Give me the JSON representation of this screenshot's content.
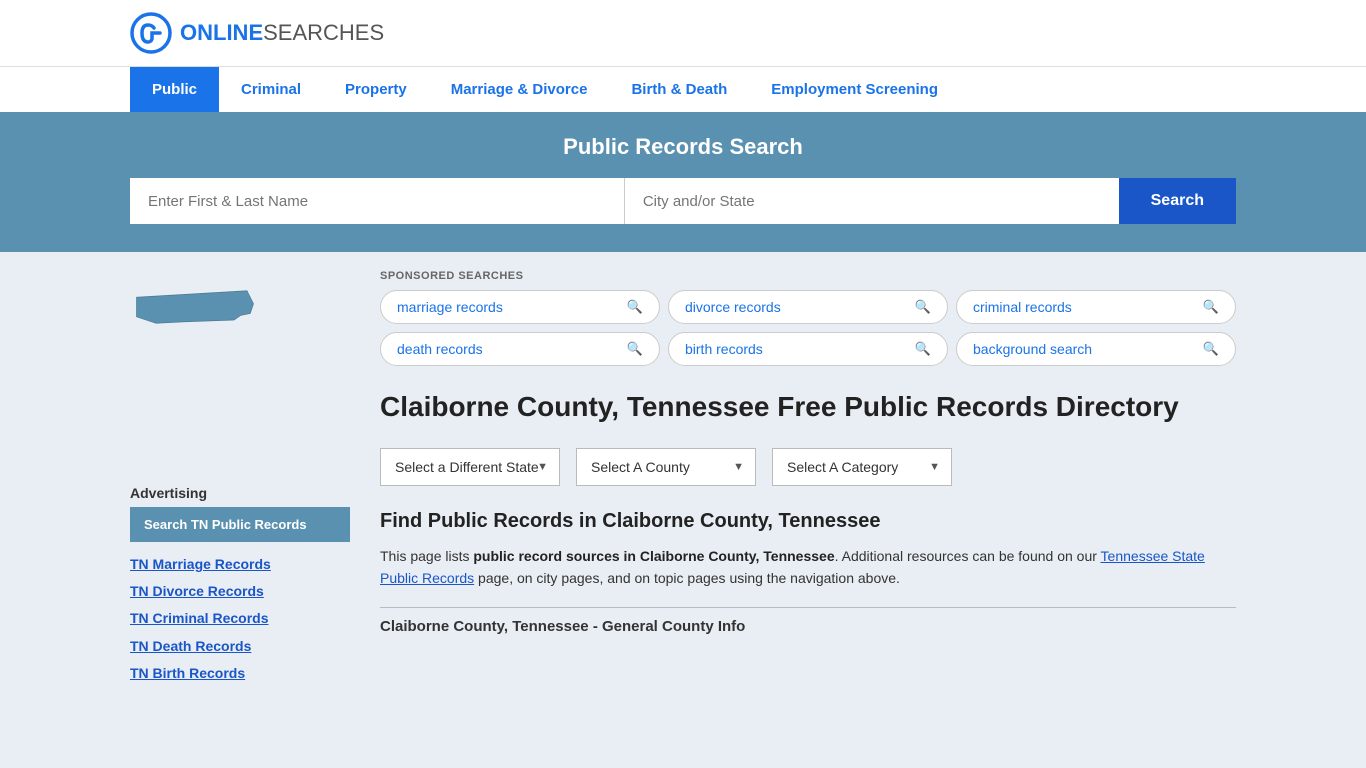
{
  "site": {
    "logo_online": "ONLINE",
    "logo_searches": "SEARCHES"
  },
  "nav": {
    "items": [
      {
        "label": "Public",
        "active": true
      },
      {
        "label": "Criminal",
        "active": false
      },
      {
        "label": "Property",
        "active": false
      },
      {
        "label": "Marriage & Divorce",
        "active": false
      },
      {
        "label": "Birth & Death",
        "active": false
      },
      {
        "label": "Employment Screening",
        "active": false
      }
    ]
  },
  "search_banner": {
    "title": "Public Records Search",
    "name_placeholder": "Enter First & Last Name",
    "location_placeholder": "City and/or State",
    "button_label": "Search"
  },
  "sponsored": {
    "label": "SPONSORED SEARCHES",
    "tags": [
      {
        "label": "marriage records"
      },
      {
        "label": "divorce records"
      },
      {
        "label": "criminal records"
      },
      {
        "label": "death records"
      },
      {
        "label": "birth records"
      },
      {
        "label": "background search"
      }
    ]
  },
  "page": {
    "title": "Claiborne County, Tennessee Free Public Records Directory",
    "dropdowns": {
      "state": "Select a Different State",
      "county": "Select A County",
      "category": "Select A Category"
    },
    "find_heading": "Find Public Records in Claiborne County, Tennessee",
    "find_body_1": "This page lists ",
    "find_body_bold": "public record sources in Claiborne County, Tennessee",
    "find_body_2": ". Additional resources can be found on our ",
    "find_link": "Tennessee State Public Records",
    "find_body_3": " page, on city pages, and on topic pages using the navigation above.",
    "general_info_title": "Claiborne County, Tennessee - General County Info"
  },
  "sidebar": {
    "map_state": "TN",
    "advertising_label": "Advertising",
    "ad_box_label": "Search TN Public Records",
    "links": [
      {
        "label": "TN Marriage Records"
      },
      {
        "label": "TN Divorce Records"
      },
      {
        "label": "TN Criminal Records"
      },
      {
        "label": "TN Death Records"
      },
      {
        "label": "TN Birth Records"
      }
    ]
  }
}
